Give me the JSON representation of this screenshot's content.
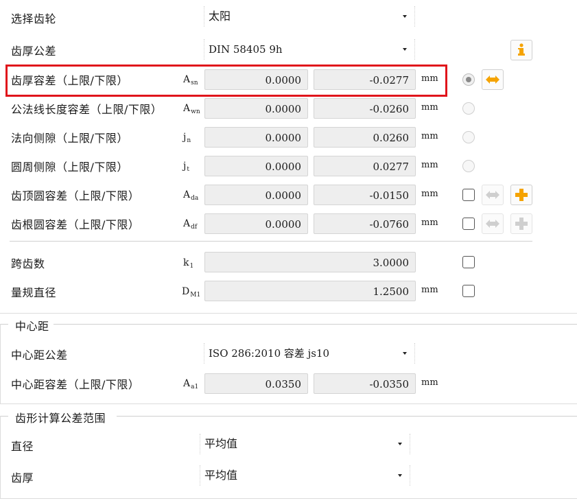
{
  "gear_select": {
    "label": "选择齿轮",
    "value": "太阳"
  },
  "tooth_thickness_tol": {
    "label": "齿厚公差",
    "value": "DIN 58405 9h"
  },
  "rows": [
    {
      "label": "齿厚容差（上限/下限）",
      "sym": "A",
      "sub": "sn",
      "upper": "0.0000",
      "lower": "-0.0277",
      "unit": "mm"
    },
    {
      "label": "公法线长度容差（上限/下限）",
      "sym": "A",
      "sub": "wn",
      "upper": "0.0000",
      "lower": "-0.0260",
      "unit": "mm"
    },
    {
      "label": "法向侧隙（上限/下限）",
      "sym": "j",
      "sub": "n",
      "upper": "0.0000",
      "lower": "0.0260",
      "unit": "mm"
    },
    {
      "label": "圆周侧隙（上限/下限）",
      "sym": "j",
      "sub": "t",
      "upper": "0.0000",
      "lower": "0.0277",
      "unit": "mm"
    },
    {
      "label": "齿顶圆容差（上限/下限）",
      "sym": "A",
      "sub": "da",
      "upper": "0.0000",
      "lower": "-0.0150",
      "unit": "mm"
    },
    {
      "label": "齿根圆容差（上限/下限）",
      "sym": "A",
      "sub": "df",
      "upper": "0.0000",
      "lower": "-0.0760",
      "unit": "mm"
    }
  ],
  "span_teeth": {
    "label": "跨齿数",
    "sym": "k",
    "sub": "1",
    "value": "3.0000"
  },
  "ball_diameter": {
    "label": "量规直径",
    "sym": "D",
    "sub": "M1",
    "value": "1.2500",
    "unit": "mm"
  },
  "center_distance": {
    "title": "中心距",
    "tol_label": "中心距公差",
    "tol_value": "ISO 286:2010 容差 js10",
    "range_label": "中心距容差（上限/下限）",
    "sym": "A",
    "sub": "a1",
    "upper": "0.0350",
    "lower": "-0.0350",
    "unit": "mm"
  },
  "tooth_form": {
    "title": "齿形计算公差范围",
    "diameter_label": "直径",
    "diameter_value": "平均值",
    "thickness_label": "齿厚",
    "thickness_value": "平均值"
  },
  "colors": {
    "highlight": "#e0141b",
    "accent_orange": "#f5a300",
    "arrow_gray": "#cfcfcf"
  }
}
